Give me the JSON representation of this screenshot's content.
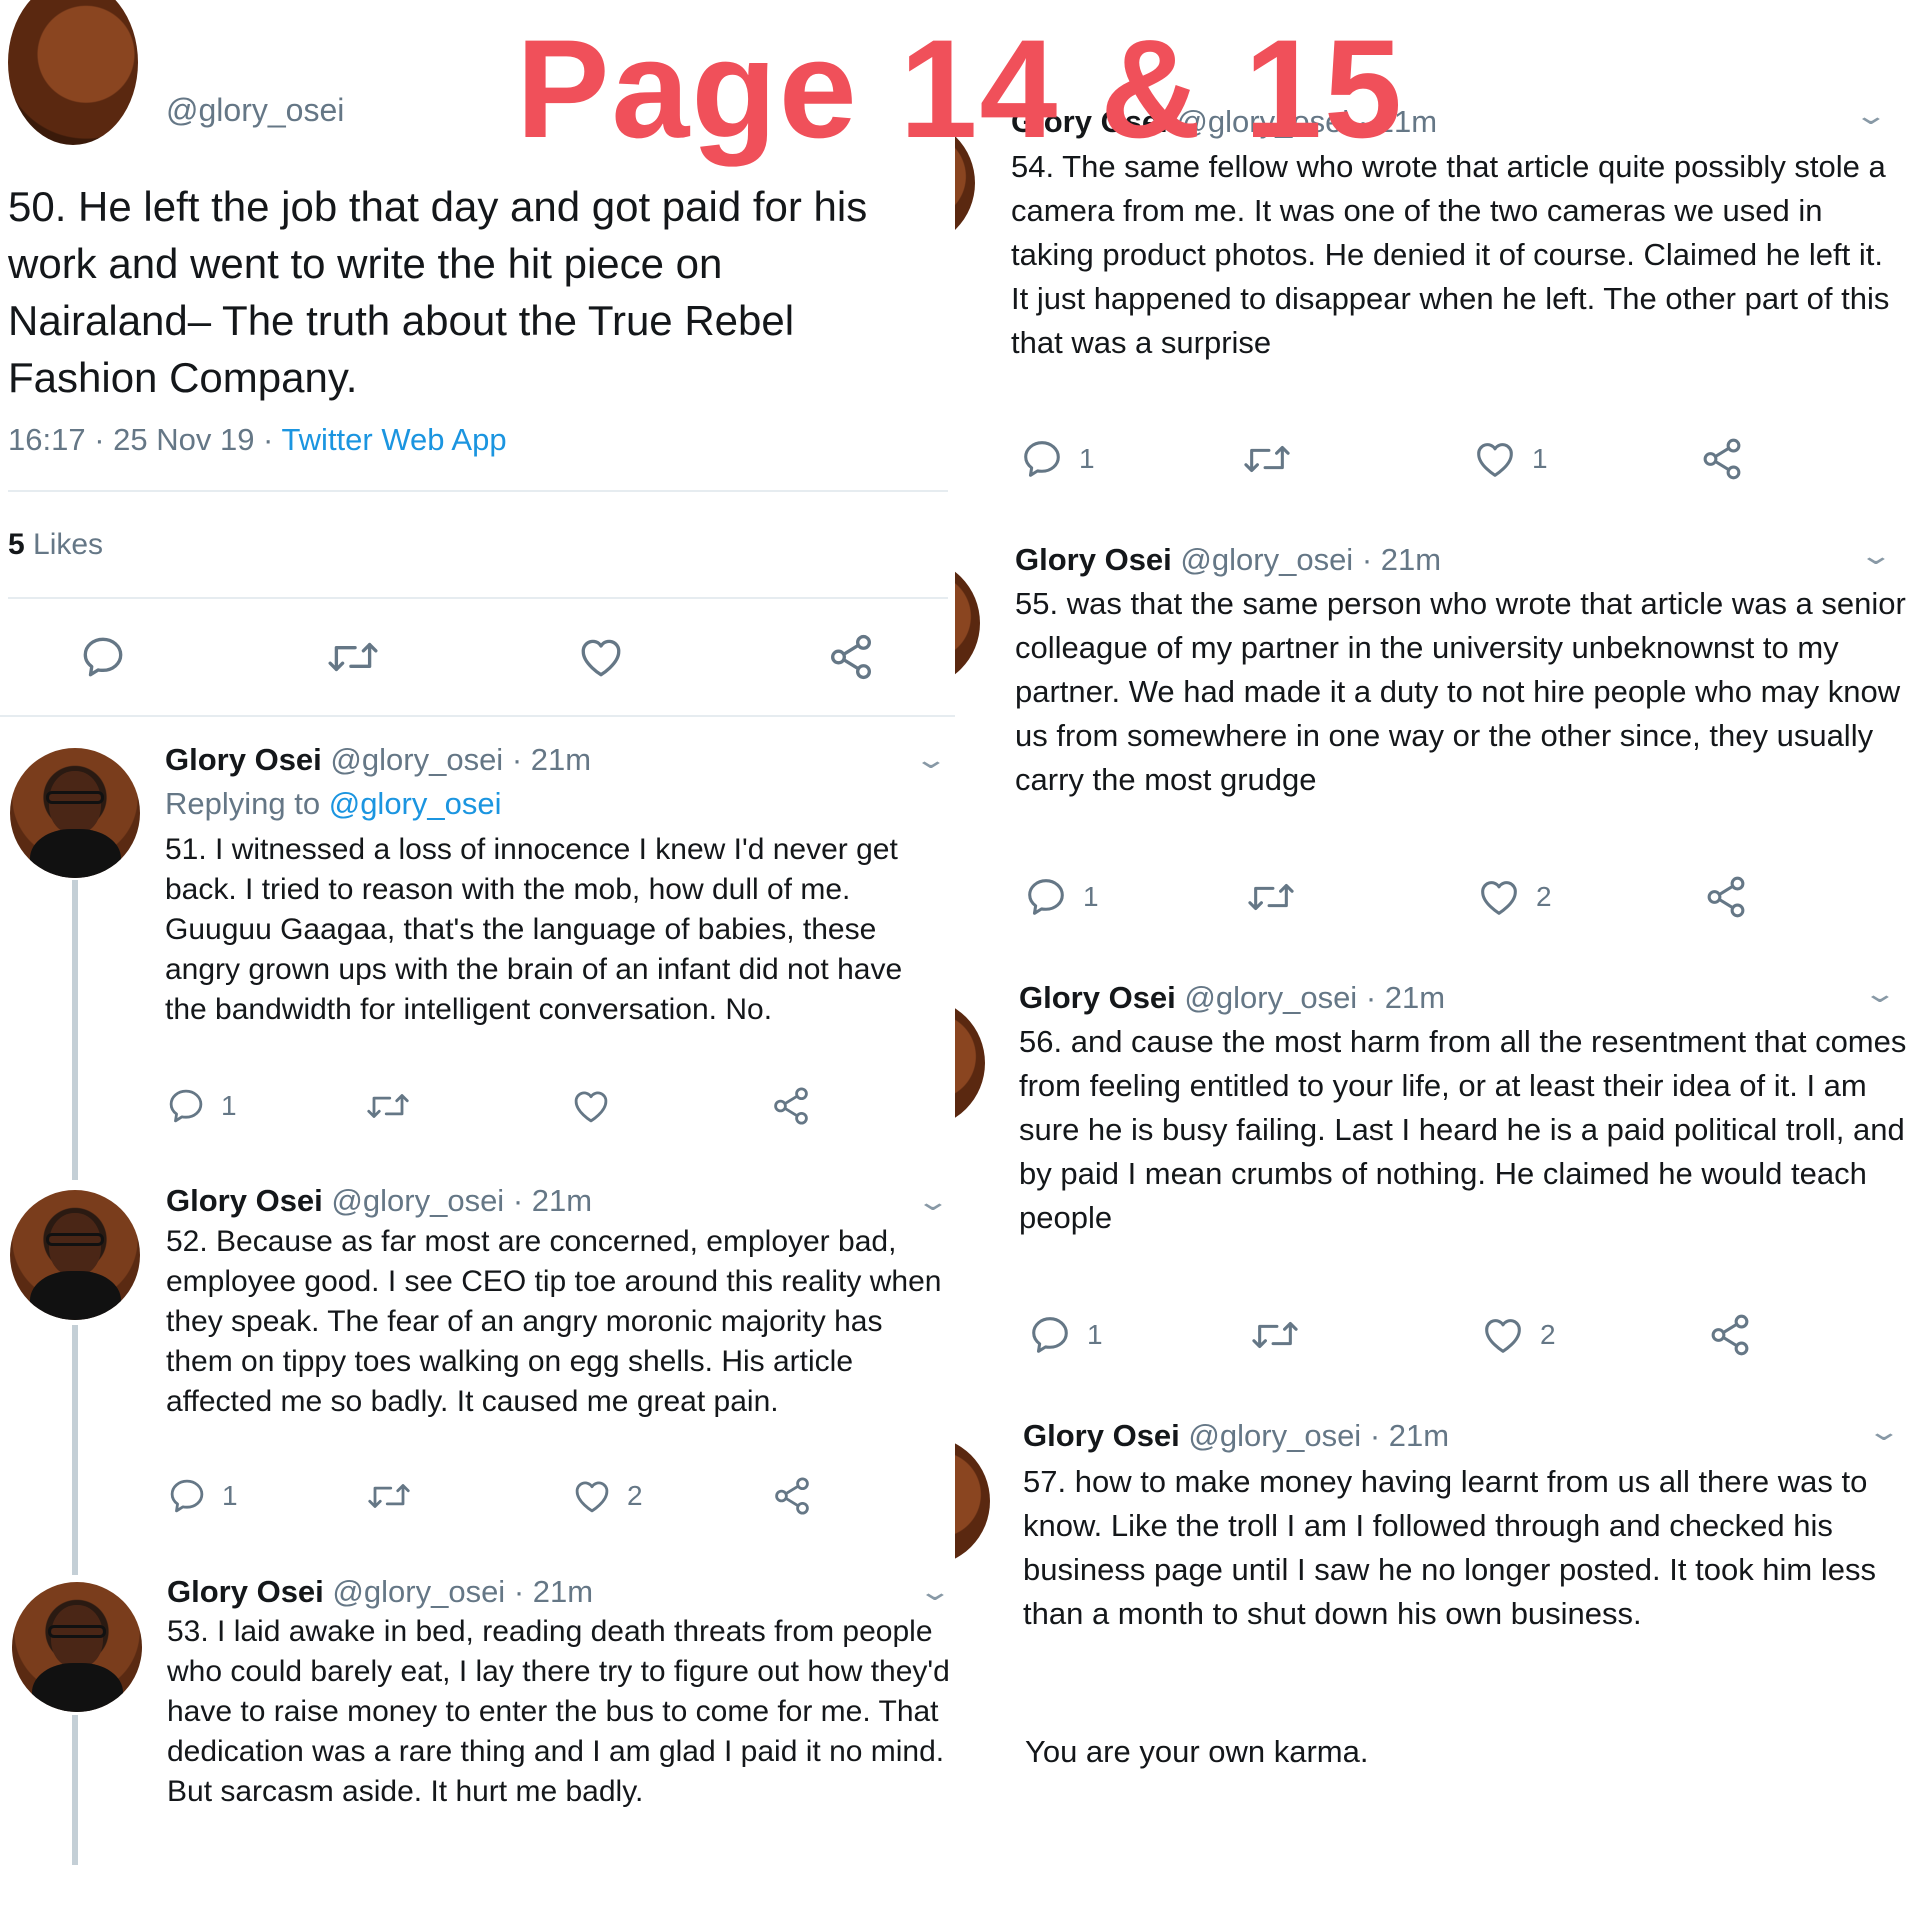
{
  "page_title": "Page 14 & 15",
  "main_tweet": {
    "handle": "@glory_osei",
    "text": "50. He left the job that day and got paid for his work and went to write the hit piece on Nairaland– The truth about the True Rebel Fashion Company.",
    "time": "16:17 · 25 Nov 19 · ",
    "source": "Twitter Web App",
    "likes_count": "5",
    "likes_label": " Likes"
  },
  "left_tweets": [
    {
      "name": "Glory Osei",
      "handle": "@glory_osei",
      "dot": " · ",
      "time": "21m",
      "replying_prefix": "Replying to ",
      "replying_handle": "@glory_osei",
      "text": "51. I witnessed a loss of innocence I knew I'd never get back. I tried to reason with the mob, how dull of me. Guuguu Gaagaa, that's the language of babies, these angry grown ups with the brain of an infant did not have the bandwidth for intelligent conversation. No.",
      "replies": "1",
      "retweets": "",
      "likes": ""
    },
    {
      "name": "Glory Osei",
      "handle": "@glory_osei",
      "dot": " · ",
      "time": "21m",
      "text": "52. Because as far most are concerned, employer bad, employee good. I see CEO tip toe around this reality when they speak. The fear of an angry moronic majority has them on tippy toes walking on egg shells. His article affected me so badly. It caused me great pain.",
      "replies": "1",
      "retweets": "",
      "likes": "2"
    },
    {
      "name": "Glory Osei",
      "handle": "@glory_osei",
      "dot": " · ",
      "time": "21m",
      "text": "53. I laid awake in bed, reading death threats from people who could barely eat, I lay there try to figure out how they'd have to raise money to enter the bus to come for me. That dedication was a rare thing and I am glad I paid it no mind. But sarcasm aside. It hurt me badly."
    }
  ],
  "right_tweets": [
    {
      "name": "Glory Osei",
      "handle": "@glory_osei",
      "dot": " · ",
      "time": "21m",
      "text": "54. The same fellow who wrote that article quite possibly stole a camera from me. It was one of the two cameras we used in taking product photos. He denied it of course. Claimed he left it. It just happened to disappear when he left. The other part of this that was a surprise",
      "replies": "1",
      "retweets": "",
      "likes": "1"
    },
    {
      "name": "Glory Osei",
      "handle": "@glory_osei",
      "dot": " · ",
      "time": "21m",
      "text": "55. was that the same person who wrote that article was a senior colleague of my partner in the university unbeknownst to my partner. We had made it a duty to not hire people who may know us from somewhere in one way or the other since, they usually carry the most grudge",
      "replies": "1",
      "retweets": "",
      "likes": "2"
    },
    {
      "name": "Glory Osei",
      "handle": "@glory_osei",
      "dot": " · ",
      "time": "21m",
      "text": "56. and cause the most harm from all the resentment that comes from feeling entitled to your life, or at least their idea of it. I am sure he is busy failing. Last I heard he is a paid political troll, and by paid I mean crumbs of nothing. He claimed he would teach people",
      "replies": "1",
      "retweets": "",
      "likes": "2"
    },
    {
      "name": "Glory Osei",
      "handle": "@glory_osei",
      "dot": " · ",
      "time": "21m",
      "text": "57. how to make money having learnt from us all there was to know. Like the troll I am I followed through and checked his business page until I saw he no longer posted. It took him less than a month to shut down his own business.",
      "text2": "You are your own karma."
    }
  ],
  "icons": {
    "reply": "reply-icon",
    "retweet": "retweet-icon",
    "like": "heart-icon",
    "share": "share-icon",
    "chevron": "chevron-down-icon"
  },
  "colors": {
    "title": "#f0505a",
    "link": "#1b95e0",
    "secondary": "#657786"
  }
}
